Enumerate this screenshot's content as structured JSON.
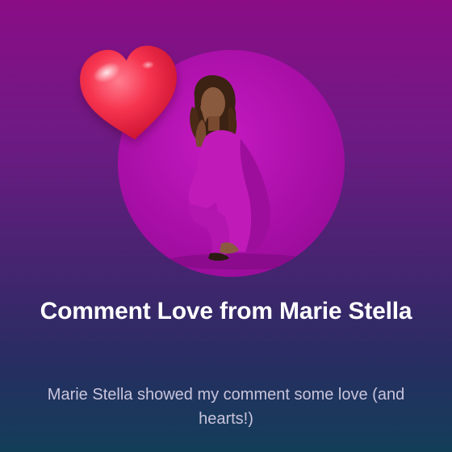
{
  "card": {
    "title": "Comment Love from Marie Stella",
    "subtitle": "Marie Stella showed my comment some love (and hearts!)"
  },
  "icons": {
    "heart": "heart-icon",
    "avatar": "profile-photo"
  },
  "colors": {
    "background_top": "#8a0d86",
    "background_bottom": "#123e58",
    "avatar_bg": "#b014ad",
    "heart": "#f1304f",
    "title": "#ffffff",
    "subtitle": "#c9c4dc"
  }
}
